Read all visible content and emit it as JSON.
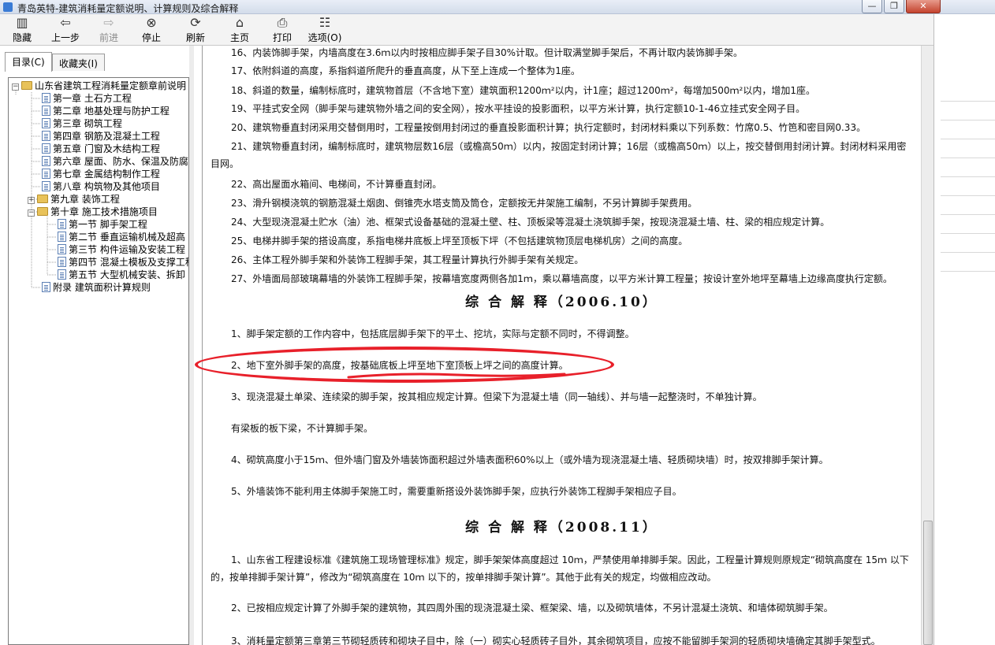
{
  "window": {
    "title": "青岛英特-建筑消耗量定额说明、计算规则及综合解释",
    "controls": {
      "minimize": "—",
      "maximize": "❐",
      "close": "✕"
    }
  },
  "toolbar": {
    "items": [
      {
        "label": "隐藏",
        "icon": "hide-pane-icon",
        "glyph": "▥",
        "enabled": true
      },
      {
        "label": "上一步",
        "icon": "back-arrow-icon",
        "glyph": "⇦",
        "enabled": true
      },
      {
        "label": "前进",
        "icon": "forward-arrow-icon",
        "glyph": "⇨",
        "enabled": false
      },
      {
        "label": "停止",
        "icon": "stop-icon",
        "glyph": "⊗",
        "enabled": true
      },
      {
        "label": "刷新",
        "icon": "refresh-icon",
        "glyph": "⟳",
        "enabled": true
      },
      {
        "label": "主页",
        "icon": "home-icon",
        "glyph": "⌂",
        "enabled": true
      },
      {
        "label": "打印",
        "icon": "print-icon",
        "glyph": "⎙",
        "enabled": true
      },
      {
        "label": "选项(O)",
        "icon": "options-icon",
        "glyph": "☷",
        "enabled": true
      }
    ]
  },
  "nav_tabs": {
    "contents": "目录(C)",
    "favorites": "收藏夹(I)"
  },
  "tree": {
    "root": "山东省建筑工程消耗量定额章前说明",
    "chapters": [
      "第一章 土石方工程",
      "第二章 地基处理与防护工程",
      "第三章 砌筑工程",
      "第四章 钢筋及混凝土工程",
      "第五章 门窗及木结构工程",
      "第六章 屋面、防水、保温及防腐",
      "第七章 金属结构制作工程",
      "第八章 构筑物及其他项目"
    ],
    "chapter9": "第九章 装饰工程",
    "chapter10": "第十章 施工技术措施项目",
    "sections": [
      "第一节 脚手架工程",
      "第二节 垂直运输机械及超高",
      "第三节 构件运输及安装工程",
      "第四节 混凝土模板及支撑工程",
      "第五节  大型机械安装、拆卸"
    ],
    "appendix": "附录 建筑面积计算规则"
  },
  "content": {
    "rules": [
      "16、内装饰脚手架，内墙高度在3.6ｍ以内时按相应脚手架子目30%计取。但计取满堂脚手架后，不再计取内装饰脚手架。",
      "17、依附斜道的高度，系指斜道所爬升的垂直高度，从下至上连成一个整体为1座。",
      "18、斜道的数量，编制标底时，建筑物首层（不含地下室）建筑面积1200ｍ²以内，计1座；超过1200ｍ²，每增加500ｍ²以内，增加1座。",
      "19、平挂式安全网（脚手架与建筑物外墙之间的安全网），按水平挂设的投影面积，以平方米计算，执行定额10-1-46立挂式安全网子目。",
      "20、建筑物垂直封闭采用交替倒用时，工程量按倒用封闭过的垂直投影面积计算；执行定额时，封闭材料乘以下列系数：竹席0.5、竹笆和密目网0.33。",
      "21、建筑物垂直封闭，编制标底时，建筑物层数16层（或檐高50ｍ）以内，按固定封闭计算；16层（或檐高50ｍ）以上，按交替倒用封闭计算。封闭材料采用密目网。",
      "22、高出屋面水箱间、电梯间，不计算垂直封闭。",
      "23、滑升钢模浇筑的钢筋混凝土烟囱、倒锥壳水塔支筒及筒仓，定额按无井架施工编制，不另计算脚手架费用。",
      "24、大型现浇混凝土贮水（油）池、框架式设备基础的混凝土壁、柱、顶板梁等混凝土浇筑脚手架，按现浇混凝土墙、柱、梁的相应规定计算。",
      "25、电梯井脚手架的搭设高度，系指电梯井底板上坪至顶板下坪（不包括建筑物顶层电梯机房）之间的高度。",
      "26、主体工程外脚手架和外装饰工程脚手架，其工程量计算执行外脚手架有关规定。",
      "27、外墙面局部玻璃幕墙的外装饰工程脚手架，按幕墙宽度两侧各加1ｍ，乘以幕墙高度，以平方米计算工程量；按设计室外地坪至幕墙上边缘高度执行定额。"
    ],
    "section_2006": {
      "title": "综 合 解 释（2006.10）",
      "items": [
        "1、脚手架定额的工作内容中，包括底层脚手架下的平土、挖坑，实际与定额不同时，不得调整。",
        "2、地下室外脚手架的高度，按基础底板上坪至地下室顶板上坪之间的高度计算。",
        "3、现浇混凝土单梁、连续梁的脚手架，按其相应规定计算。但梁下为混凝土墙（同一轴线）、并与墙一起整浇时，不单独计算。",
        "有梁板的板下梁，不计算脚手架。",
        "4、砌筑高度小于15ｍ、但外墙门窗及外墙装饰面积超过外墙表面积60%以上（或外墙为现浇混凝土墙、轻质砌块墙）时，按双排脚手架计算。",
        "5、外墙装饰不能利用主体脚手架施工时，需要重新搭设外装饰脚手架，应执行外装饰工程脚手架相应子目。"
      ]
    },
    "section_2008": {
      "title": "综 合 解 释（2008.11）",
      "items": [
        "1、山东省工程建设标准《建筑施工现场管理标准》规定，脚手架架体高度超过 10ｍ，严禁使用单排脚手架。因此，工程量计算规则原规定“砌筑高度在 15ｍ 以下的，按单排脚手架计算”，修改为“砌筑高度在 10ｍ 以下的，按单排脚手架计算”。其他于此有关的规定，均做相应改动。",
        "2、已按相应规定计算了外脚手架的建筑物，其四周外围的现浇混凝土梁、框架梁、墙，以及砌筑墙体，不另计混凝土浇筑、和墙体砌筑脚手架。",
        "3、消耗量定额第三章第三节砌轻质砖和砌块子目中，除（一）砌实心轻质砖子目外，其余砌筑项目，应按不能留脚手架洞的轻质砌块墙确定其脚手架型式。"
      ]
    }
  },
  "annotation": {
    "color": "#e8202a"
  }
}
